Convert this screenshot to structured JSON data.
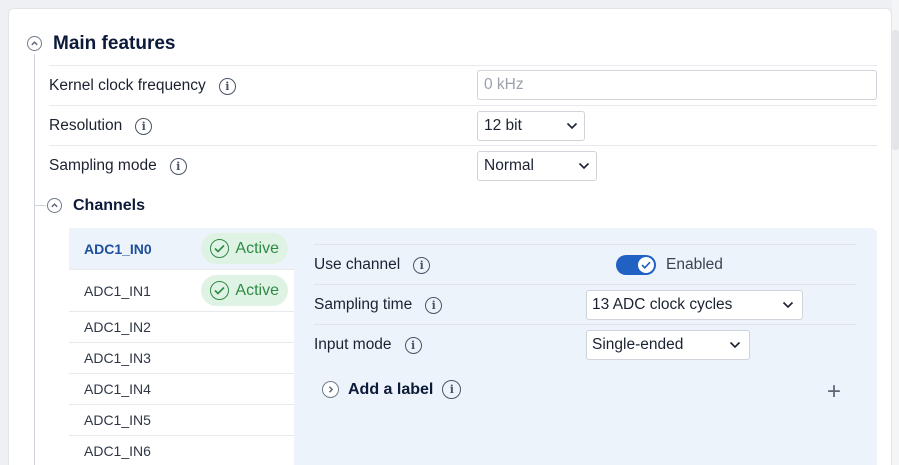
{
  "main_features": {
    "title": "Main features",
    "rows": {
      "kernel_clock": {
        "label": "Kernel clock frequency",
        "placeholder": "0 kHz"
      },
      "resolution": {
        "label": "Resolution",
        "value": "12 bit"
      },
      "sampling_mode": {
        "label": "Sampling mode",
        "value": "Normal"
      }
    }
  },
  "channels": {
    "title": "Channels",
    "items": [
      {
        "label": "ADC1_IN0",
        "status": "Active"
      },
      {
        "label": "ADC1_IN1",
        "status": "Active"
      },
      {
        "label": "ADC1_IN2"
      },
      {
        "label": "ADC1_IN3"
      },
      {
        "label": "ADC1_IN4"
      },
      {
        "label": "ADC1_IN5"
      },
      {
        "label": "ADC1_IN6"
      }
    ],
    "selected_index": 0,
    "detail": {
      "use_channel": {
        "label": "Use channel",
        "state": "Enabled"
      },
      "sampling_time": {
        "label": "Sampling time",
        "value": "13 ADC clock cycles"
      },
      "input_mode": {
        "label": "Input mode",
        "value": "Single-ended"
      },
      "add_label": "Add a label"
    }
  },
  "colors": {
    "accent": "#2161c4",
    "active_badge_bg": "#dff3e4",
    "active_badge_text": "#2f8a45",
    "selected_bg": "#edf3fb"
  },
  "icons": [
    "collapse-up-icon",
    "info-icon",
    "chevron-down-icon",
    "check-circle-icon",
    "toggle-check-icon",
    "expand-right-icon",
    "plus-icon"
  ]
}
